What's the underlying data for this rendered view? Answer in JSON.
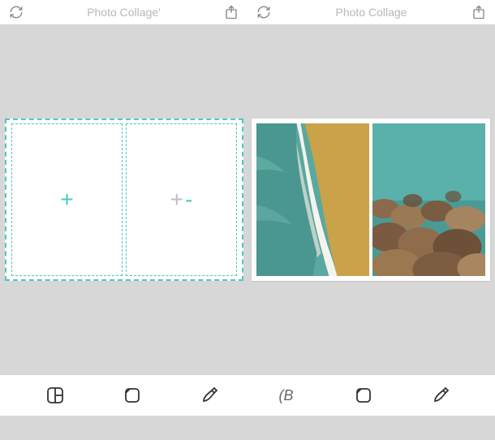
{
  "header": {
    "left": {
      "title": "Photo Collage'"
    },
    "right": {
      "title": "Photo Collage"
    }
  },
  "slots": {
    "left_icon": "+",
    "right_icon": "+"
  },
  "toolbar": {
    "layout_label": "",
    "border_label": "",
    "edit_label": "",
    "middle_label": "(B",
    "border2_label": "",
    "edit2_label": ""
  },
  "icons": {
    "refresh": "refresh-icon",
    "share": "share-icon",
    "layout": "layout-icon",
    "border": "border-icon",
    "edit": "edit-icon"
  }
}
